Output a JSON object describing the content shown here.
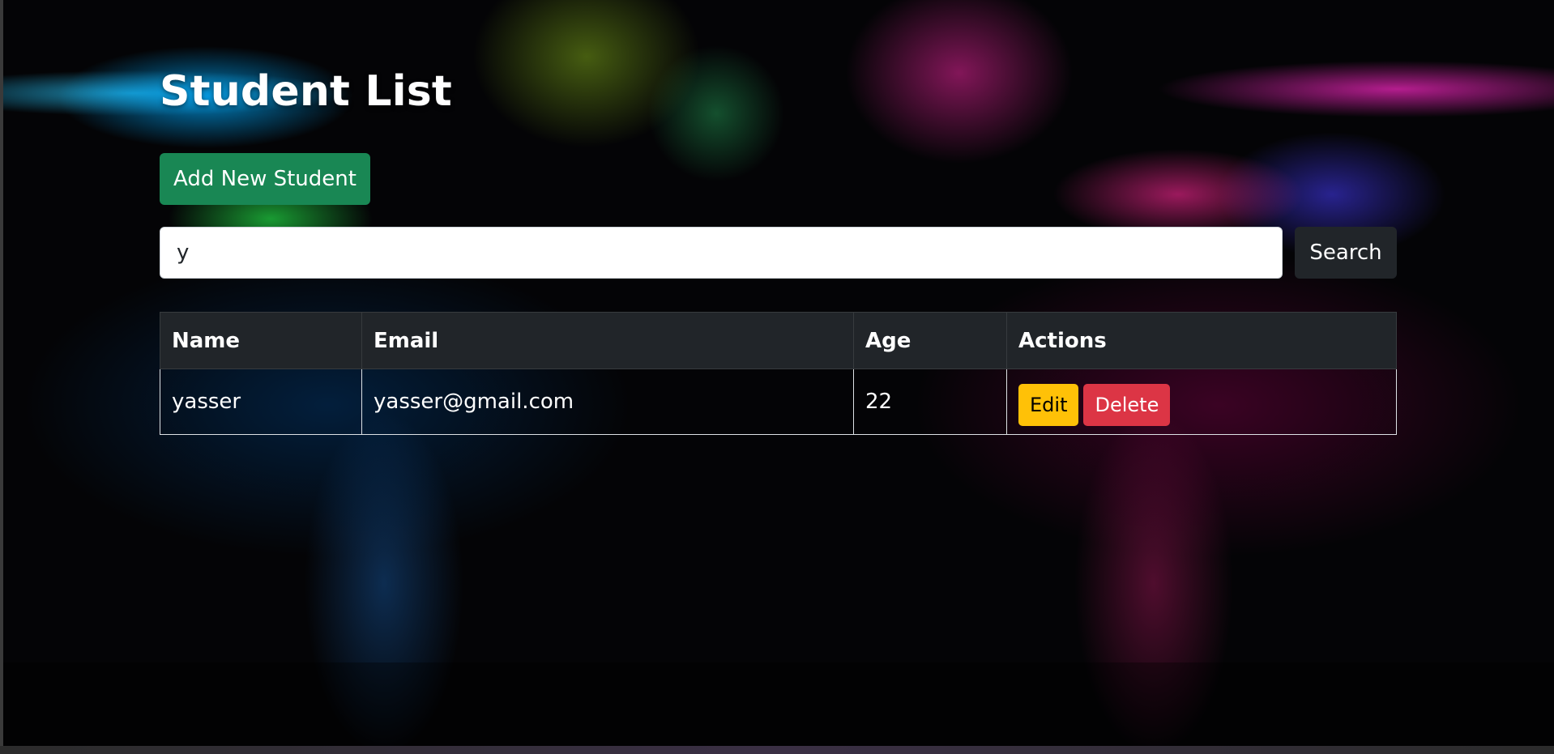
{
  "page": {
    "title": "Student List"
  },
  "toolbar": {
    "add_label": "Add New Student"
  },
  "search": {
    "value": "y",
    "button_label": "Search"
  },
  "table": {
    "headers": [
      "Name",
      "Email",
      "Age",
      "Actions"
    ],
    "rows": [
      {
        "name": "yasser",
        "email": "yasser@gmail.com",
        "age": "22",
        "edit_label": "Edit",
        "delete_label": "Delete"
      }
    ]
  },
  "colors": {
    "add_button": "#198754",
    "search_button": "#212529",
    "table_header": "#212529",
    "edit_button": "#ffc107",
    "delete_button": "#dc3545"
  }
}
